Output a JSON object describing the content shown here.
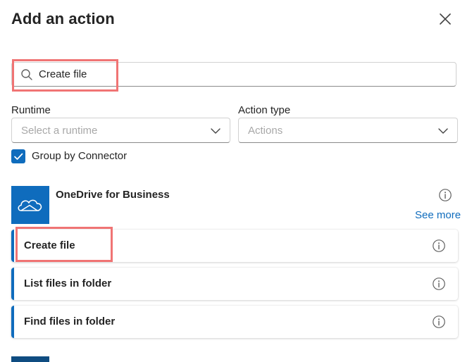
{
  "header": {
    "title": "Add an action"
  },
  "search": {
    "value": "Create file"
  },
  "filters": {
    "runtime_label": "Runtime",
    "runtime_placeholder": "Select a runtime",
    "action_type_label": "Action type",
    "action_type_placeholder": "Actions"
  },
  "group_by": {
    "label": "Group by Connector",
    "checked": true
  },
  "connector": {
    "name": "OneDrive for Business",
    "see_more": "See more",
    "icon": "onedrive-cloud-icon",
    "brand_color": "#0f6cbd"
  },
  "actions": [
    {
      "label": "Create file"
    },
    {
      "label": "List files in folder"
    },
    {
      "label": "Find files in folder"
    }
  ],
  "colors": {
    "accent": "#0f6cbd",
    "highlight": "#f07474"
  }
}
